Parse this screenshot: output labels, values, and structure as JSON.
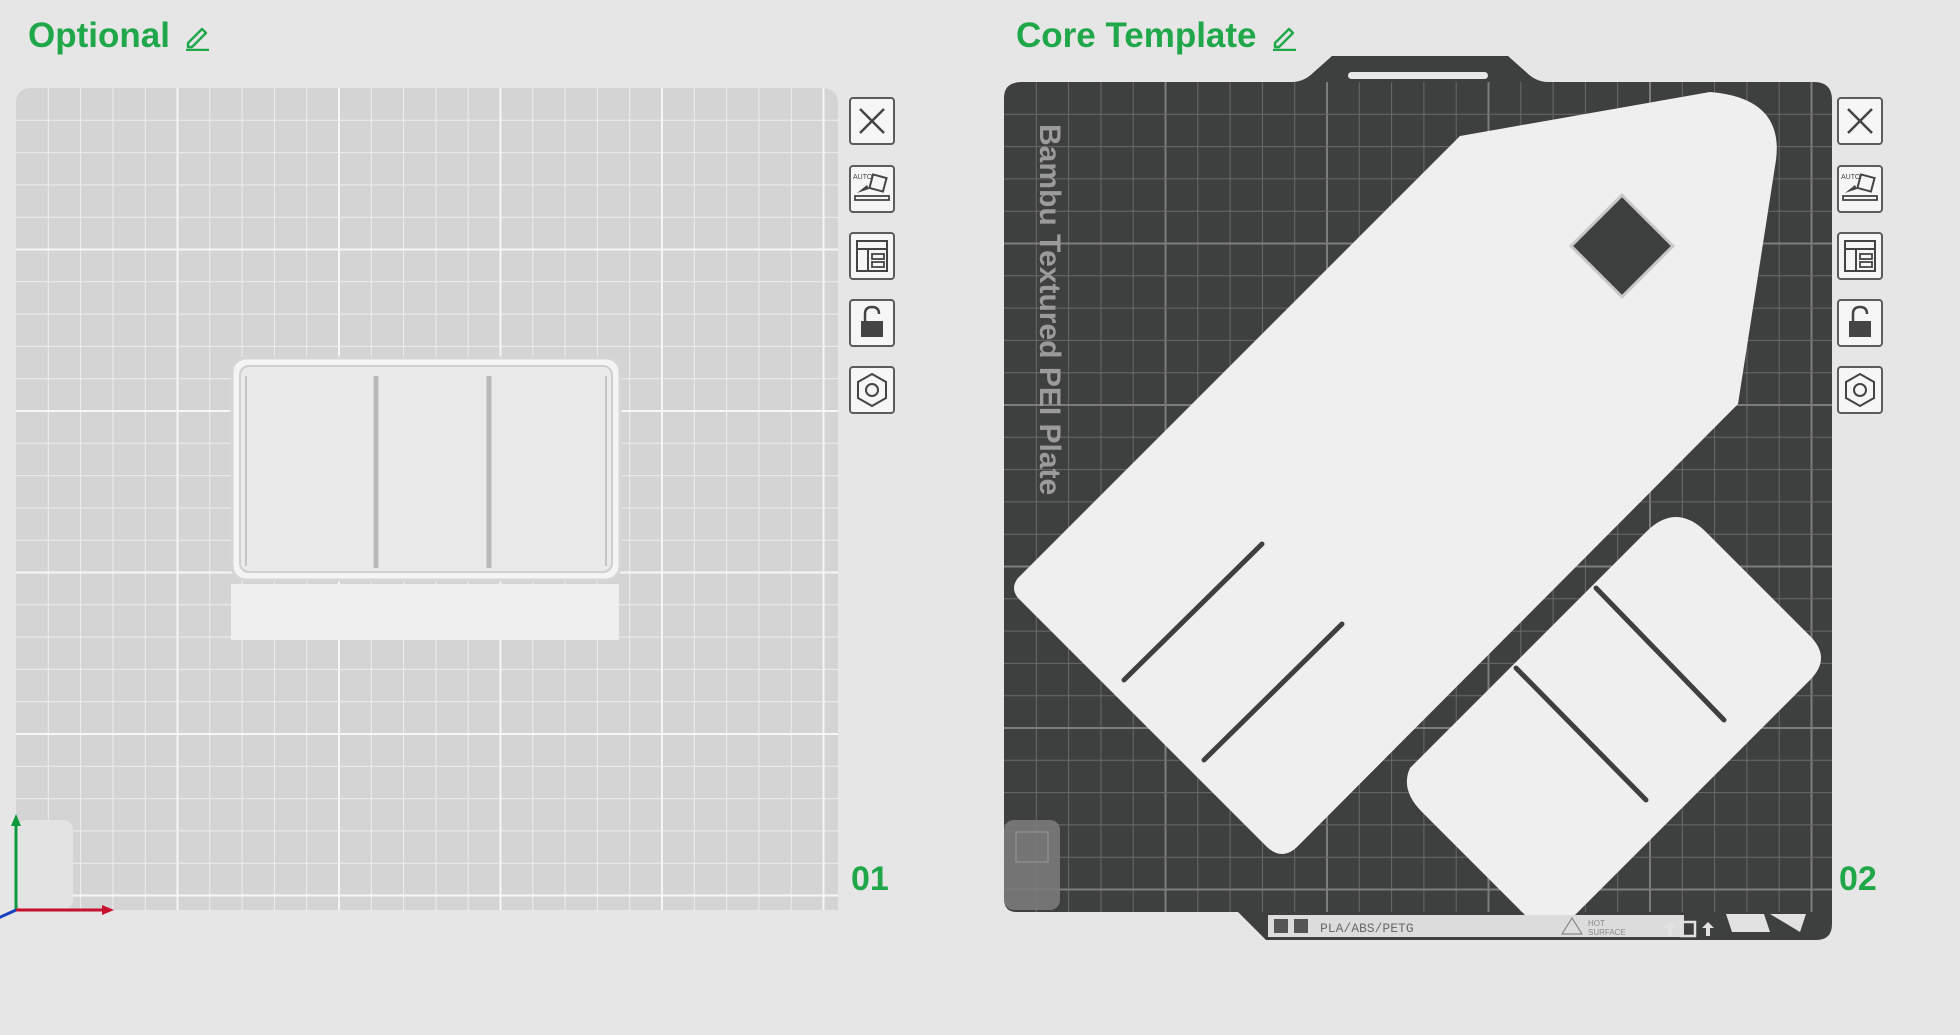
{
  "plates": [
    {
      "name": "Optional",
      "number": "01",
      "selected": false
    },
    {
      "name": "Core Template",
      "number": "02",
      "selected": true,
      "bed_name": "Bambu Textured PEI Plate",
      "bed_label": {
        "filaments": "PLA/ABS/PETG",
        "warning_line1": "HOT",
        "warning_line2": "SURFACE"
      }
    }
  ],
  "plate_tools": [
    {
      "icon": "close-icon",
      "action": "Remove plate"
    },
    {
      "icon": "auto-orient-icon",
      "action": "Auto orient",
      "badge": "AUTO"
    },
    {
      "icon": "arrange-icon",
      "action": "Arrange"
    },
    {
      "icon": "lock-icon",
      "action": "Lock plate"
    },
    {
      "icon": "settings-icon",
      "action": "Plate settings"
    }
  ],
  "colors": {
    "accent": "#1fa74a",
    "bed_light": "#d4d4d4",
    "bed_dark": "#3e3f3f",
    "grid_light": "#eeeeee",
    "grid_dark": "#6a6a6a",
    "object": "#efefef",
    "axis_x": "#c8102e",
    "axis_y": "#0e9a3c",
    "axis_z": "#1a3fbf"
  }
}
